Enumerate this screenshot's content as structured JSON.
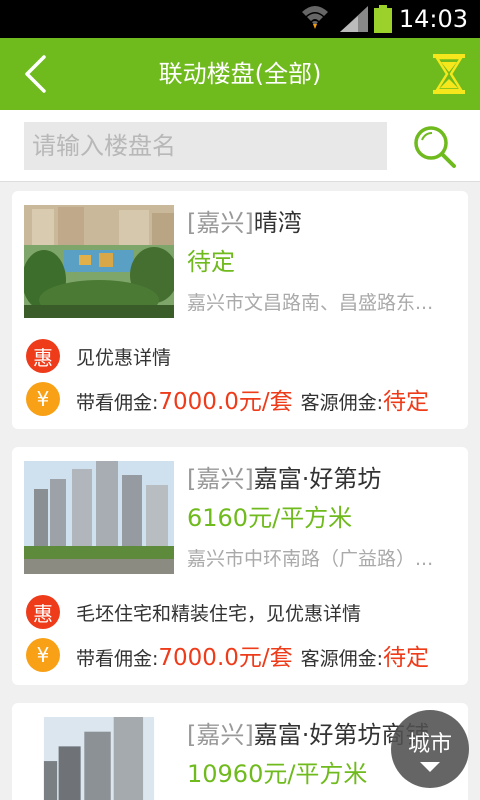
{
  "status_bar": {
    "time": "14:03"
  },
  "title_bar": {
    "title": "联动楼盘(全部)"
  },
  "search": {
    "placeholder": "请输入楼盘名",
    "value": ""
  },
  "listings": [
    {
      "city": "[嘉兴]",
      "name": "晴湾",
      "price": "待定",
      "address": "嘉兴市文昌路南、昌盛路东...",
      "promo_badge": "惠",
      "promo_text": "见优惠详情",
      "money_badge": "¥",
      "viewing_label": "带看佣金:",
      "viewing_amount": "7000.0元/套",
      "source_label": "客源佣金:",
      "source_amount": "待定"
    },
    {
      "city": "[嘉兴]",
      "name": "嘉富·好第坊",
      "price": "6160元/平方米",
      "address": "嘉兴市中环南路（广益路）...",
      "promo_badge": "惠",
      "promo_text": "毛坯住宅和精装住宅，见优惠详情",
      "money_badge": "¥",
      "viewing_label": "带看佣金:",
      "viewing_amount": "7000.0元/套",
      "source_label": "客源佣金:",
      "source_amount": "待定"
    },
    {
      "city": "[嘉兴]",
      "name": "嘉富·好第坊商铺",
      "price": "10960元/平方米"
    }
  ],
  "city_button": {
    "label": "城市"
  },
  "colors": {
    "brand_green": "#6fba1c",
    "price_red": "#ee3b1a",
    "badge_orange": "#f8a116"
  }
}
